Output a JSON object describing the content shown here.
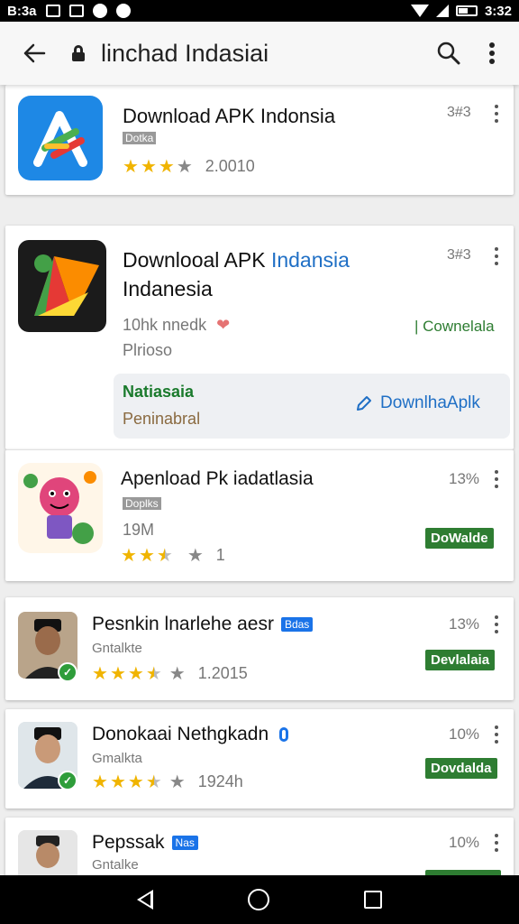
{
  "status_bar": {
    "time_left": "B:3a",
    "time_right": "3:32"
  },
  "toolbar": {
    "title": "linchad Indasiai"
  },
  "cards": [
    {
      "title": "Download APK Indonsia",
      "sub": "Dotka",
      "rating_value": "2.0010",
      "meta": "3#3"
    },
    {
      "title_a": "Downlooal APK ",
      "title_b": "Indansia",
      "title_c": "Indanesia",
      "line1": "10hk nnedk",
      "line2": "Plrioso",
      "meta": "3#3",
      "right_label": "| Cownelala",
      "promo_label": "Natiasaia",
      "promo_sub": "Peninabral",
      "promo_action": "DownlhaAplk"
    },
    {
      "title": "Apenload Pk iadatlasia",
      "sub": "Doplks",
      "size": "19M",
      "rating_value": "1",
      "pct": "13%",
      "button": "DoWalde"
    },
    {
      "title": "Pesnkin lnarlehe aesr",
      "badge": "Bdas",
      "sub": "Gntalkte",
      "rating_value": "1.2015",
      "pct": "13%",
      "button": "Devlalaia"
    },
    {
      "title": "Donokaai Nethgkadn",
      "sub": "Gmalkta",
      "rating_value": "1924h",
      "pct": "10%",
      "button": "Dovdalda"
    },
    {
      "title": "Pepssak",
      "badge": "Nas",
      "sub": "Gntalke",
      "pct": "10%"
    }
  ],
  "colors": {
    "accent_green": "#2e7d32",
    "accent_blue": "#1a73e8",
    "star": "#f0b400"
  }
}
